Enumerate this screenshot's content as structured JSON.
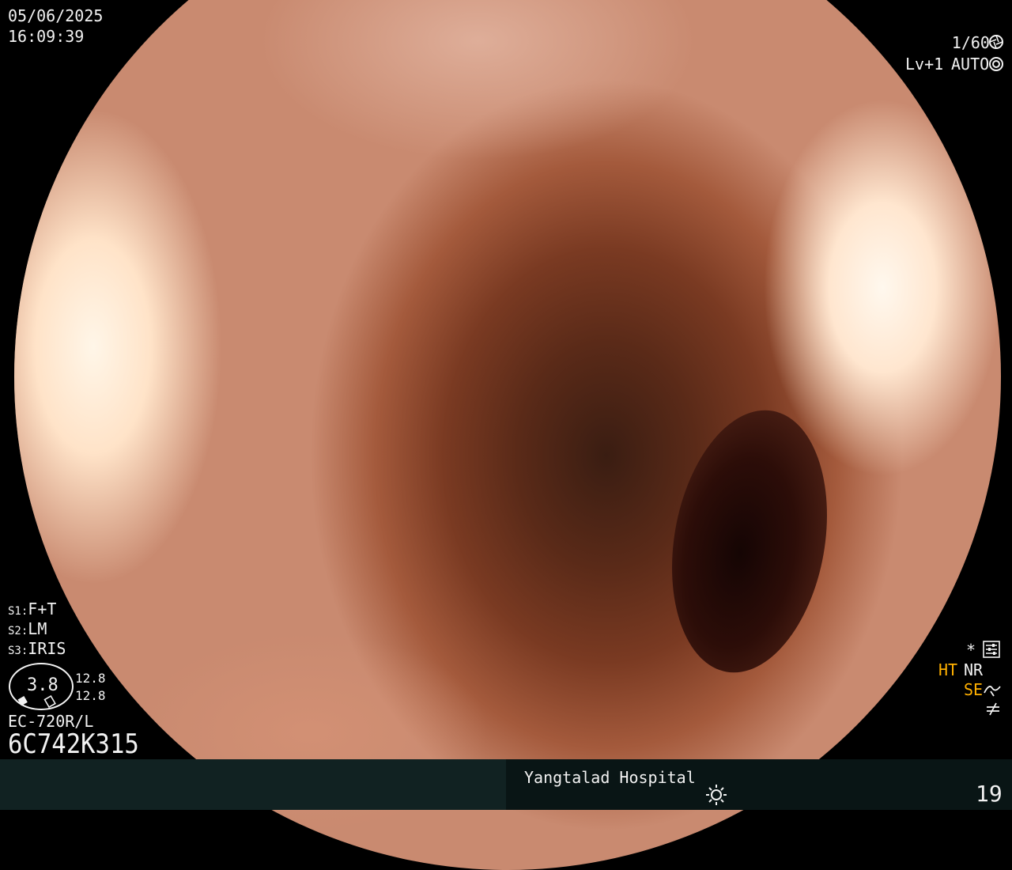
{
  "header": {
    "date": "05/06/2025",
    "time": "16:09:39",
    "shutter": "1/60",
    "level": "Lv+1",
    "auto": "AUTO"
  },
  "switches": {
    "s1_key": "S1:",
    "s1_value": "F+T",
    "s2_key": "S2:",
    "s2_value": "LM",
    "s3_key": "S3:",
    "s3_value": "IRIS"
  },
  "gauge": {
    "value": "3.8",
    "upper": "12.8",
    "lower": "12.8"
  },
  "scope": {
    "model": "EC-720R/L",
    "serial": "6C742K315"
  },
  "modes": {
    "star": "*",
    "ht": "HT",
    "nr": "NR",
    "se": "SE"
  },
  "footer": {
    "hospital": "Yangtalad Hospital",
    "page_number": "19"
  },
  "colors": {
    "accent": "#ffb000",
    "bar_left": "#112222",
    "bar_right": "#091515"
  },
  "icons": [
    "aperture-icon",
    "auto-iris-icon",
    "settings-sliders-icon",
    "structure-enhance-icon",
    "not-equal-icon",
    "brightness-sun-icon"
  ]
}
